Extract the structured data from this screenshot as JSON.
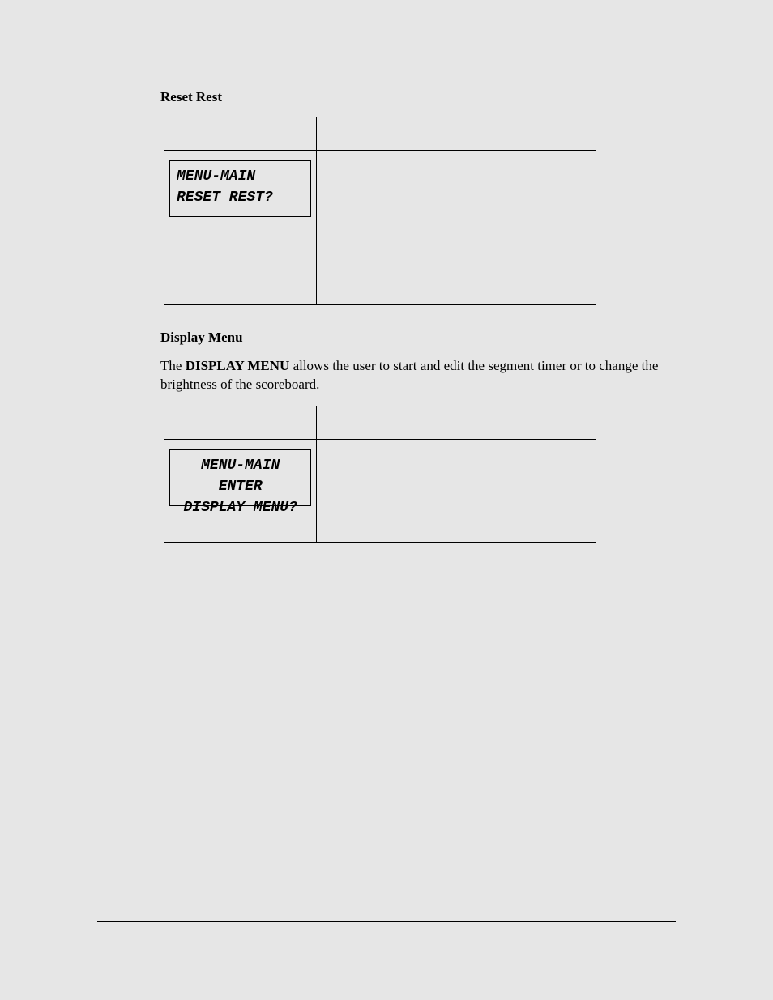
{
  "section1": {
    "title": "Reset Rest",
    "lcd_line1": "MENU-MAIN",
    "lcd_line2": "RESET REST?"
  },
  "section2": {
    "title": "Display Menu",
    "para_pre": "The ",
    "para_bold": "DISPLAY MENU",
    "para_post": " allows the user to start and edit the segment timer or to change the brightness of the scoreboard.",
    "lcd_line1": "MENU-MAIN ENTER",
    "lcd_line2": "DISPLAY MENU?"
  }
}
